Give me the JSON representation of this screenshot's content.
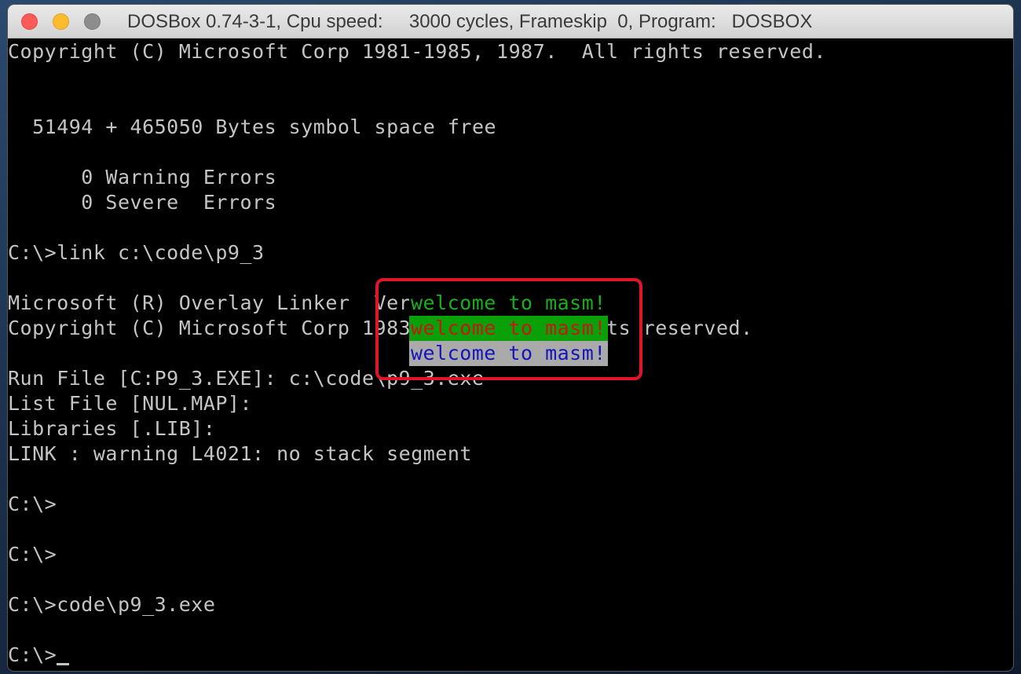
{
  "window": {
    "title": "DOSBox 0.74-3-1, Cpu speed:     3000 cycles, Frameskip  0, Program:   DOSBOX"
  },
  "console": {
    "lines": [
      "Copyright (C) Microsoft Corp 1981-1985, 1987.  All rights reserved.",
      "",
      "",
      "  51494 + 465050 Bytes symbol space free",
      "",
      "      0 Warning Errors",
      "      0 Severe  Errors",
      "",
      "C:\\>link c:\\code\\p9_3",
      "",
      "Microsoft (R) Overlay Linker  Version 3.60",
      "Copyright (C) Microsoft Corp 1983-1987.  All rights reserved.",
      "",
      "Run File [C:P9_3.EXE]: c:\\code\\p9_3.exe",
      "List File [NUL.MAP]:",
      "Libraries [.LIB]:",
      "LINK : warning L4021: no stack segment",
      "",
      "C:\\>",
      "",
      "C:\\>",
      "",
      "C:\\>code\\p9_3.exe",
      "",
      "C:\\>"
    ],
    "overlay": {
      "line1": "welcome to masm!",
      "line2": "welcome to masm!",
      "line3": "welcome to masm!"
    }
  },
  "colors": {
    "terminal_bg": "#000000",
    "terminal_fg": "#c4c4c4",
    "overlay1_fg": "#1bae1b",
    "overlay2_fg": "#c21a12",
    "overlay2_bg": "#0aa00a",
    "overlay3_fg": "#1616b8",
    "overlay3_bg": "#aaaaaa",
    "highlight_border": "#e0152a"
  },
  "icons": {
    "close": "close-icon",
    "minimize": "minimize-icon",
    "zoom": "zoom-icon"
  }
}
